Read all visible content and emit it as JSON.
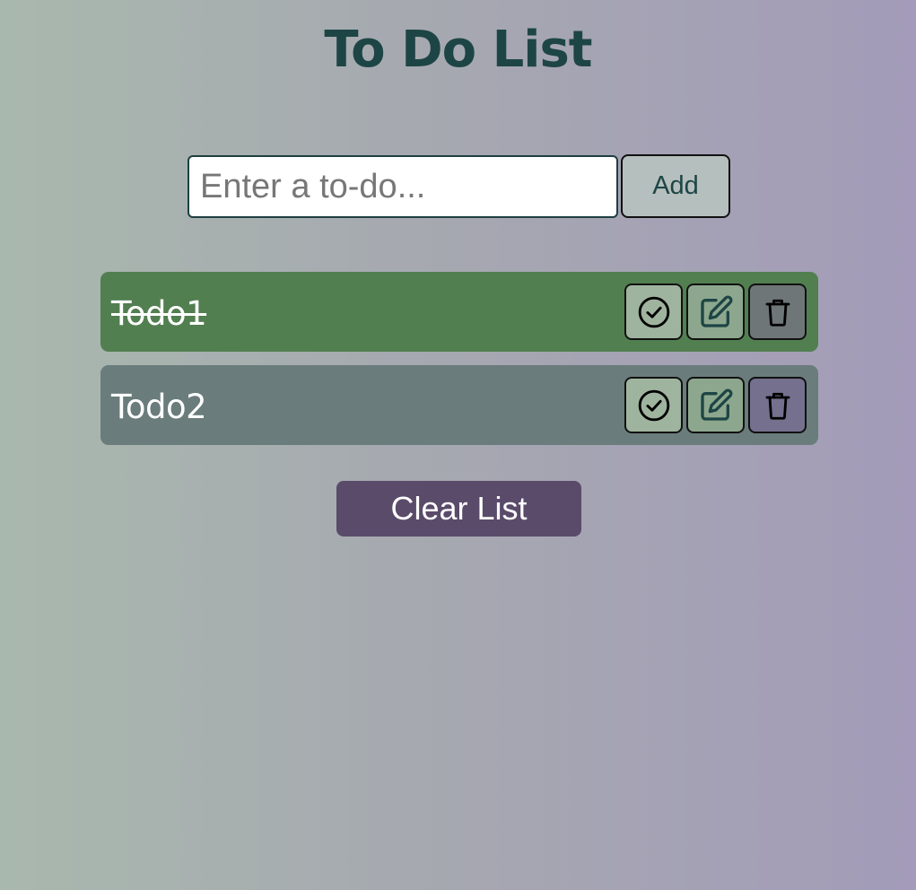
{
  "app": {
    "title": "To Do List"
  },
  "input": {
    "placeholder": "Enter a to-do...",
    "value": ""
  },
  "add_button": {
    "label": "Add"
  },
  "todos": [
    {
      "text": "Todo1",
      "completed": true,
      "color": "#527f50"
    },
    {
      "text": "Todo2",
      "completed": false,
      "color": "#6a7c7b"
    }
  ],
  "actions": {
    "complete_icon": "check-circle-icon",
    "edit_icon": "edit-icon",
    "delete_icon": "trash-icon"
  },
  "clear_button": {
    "label": "Clear List",
    "color": "#5a4b6a"
  },
  "colors": {
    "title": "#1e4545",
    "gradient_start": "#a9b8ae",
    "gradient_end": "#a39bb9"
  }
}
